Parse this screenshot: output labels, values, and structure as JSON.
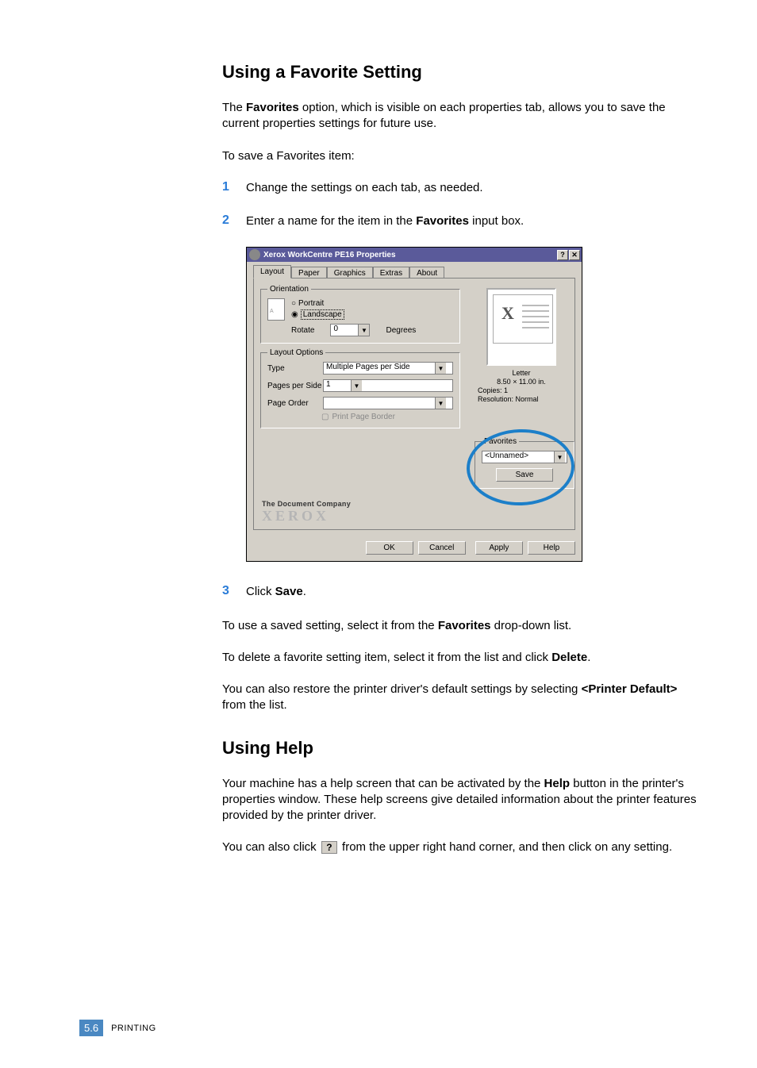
{
  "headings": {
    "h1": "Using a Favorite Setting",
    "h2": "Using Help"
  },
  "paragraphs": {
    "p1a": "The ",
    "p1b": "Favorites",
    "p1c": " option, which is visible on each properties tab, allows you to save the current properties settings for future use.",
    "p2": "To save a Favorites item:",
    "p3a": "Click ",
    "p3b": "Save",
    "p3c": ".",
    "p4a": "To use a saved setting, select it from the ",
    "p4b": "Favorites",
    "p4c": " drop-down list.",
    "p5a": "To delete a favorite setting item, select it from the list and click ",
    "p5b": "Delete",
    "p5c": ".",
    "p6a": "You can also restore the printer driver's default settings by selecting ",
    "p6b": "<Printer Default>",
    "p6c": " from the list.",
    "p7a": "Your machine has a help screen that can be activated by the ",
    "p7b": "Help",
    "p7c": " button in the printer's properties window. These help screens give detailed information about the printer features provided by the printer driver.",
    "p8a": "You can also click ",
    "p8b": " from the upper right hand corner, and then click on any setting."
  },
  "steps": {
    "s1n": "1",
    "s1t": "Change the settings on each tab, as needed.",
    "s2n": "2",
    "s2ta": "Enter a name for the item in the ",
    "s2tb": "Favorites",
    "s2tc": " input box.",
    "s3n": "3"
  },
  "dialog": {
    "title": "Xerox WorkCentre PE16 Properties",
    "help_btn": "?",
    "close_btn": "✕",
    "tabs": [
      "Layout",
      "Paper",
      "Graphics",
      "Extras",
      "About"
    ],
    "orientation": {
      "legend": "Orientation",
      "portrait": "Portrait",
      "landscape": "Landscape",
      "rotate_label": "Rotate",
      "rotate_value": "0",
      "degrees": "Degrees"
    },
    "layout_options": {
      "legend": "Layout Options",
      "type_label": "Type",
      "type_value": "Multiple Pages per Side",
      "pps_label": "Pages per Side",
      "pps_value": "1",
      "order_label": "Page Order",
      "order_value": "",
      "print_border": "Print Page Border"
    },
    "preview": {
      "paper_name": "Letter",
      "paper_size": "8.50 × 11.00 in.",
      "copies": "Copies: 1",
      "resolution": "Resolution: Normal"
    },
    "favorites": {
      "legend": "Favorites",
      "value": "<Unnamed>",
      "save": "Save"
    },
    "brand_line1": "The Document Company",
    "brand_line2": "XEROX",
    "buttons": {
      "ok": "OK",
      "cancel": "Cancel",
      "apply": "Apply",
      "help": "Help"
    }
  },
  "inline_help_icon": "?",
  "footer": {
    "page": "5.6",
    "section": "PRINTING"
  }
}
